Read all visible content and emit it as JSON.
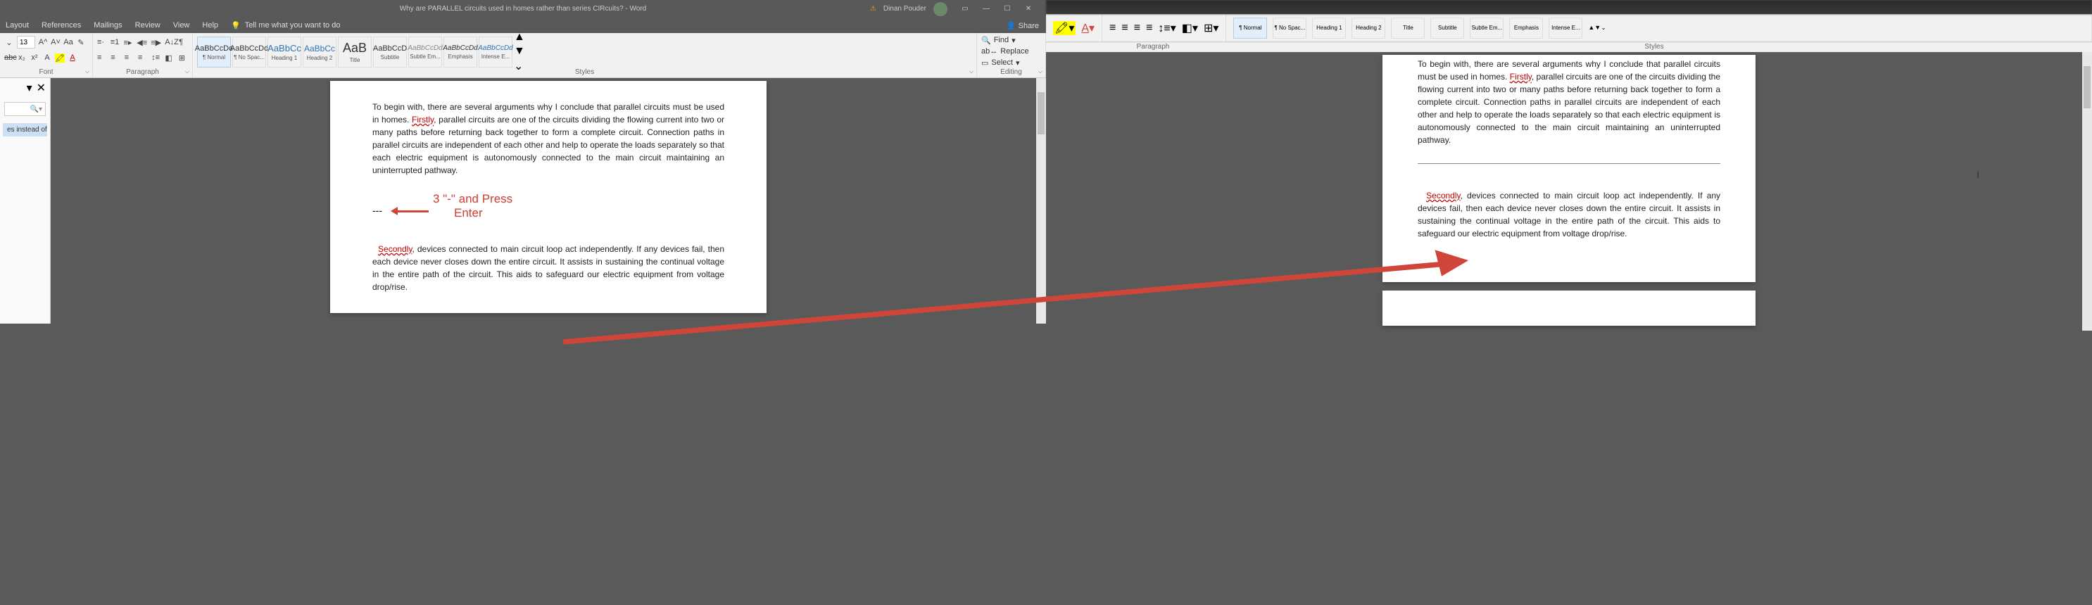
{
  "titlebar": {
    "doc_title": "Why are PARALLEL circuits used in homes rather than series CIRcuits? - Word",
    "user_hint": "Dinan Pouder"
  },
  "ribbon_tabs": {
    "layout": "Layout",
    "references": "References",
    "mailings": "Mailings",
    "review": "Review",
    "view": "View",
    "help": "Help",
    "tell_me": "Tell me what you want to do",
    "share": "Share"
  },
  "font": {
    "size": "13",
    "group_label": "Font"
  },
  "paragraph": {
    "group_label": "Paragraph"
  },
  "styles": {
    "group_label": "Styles",
    "items": [
      {
        "sample": "AaBbCcDd",
        "name": "¶ Normal",
        "cls": ""
      },
      {
        "sample": "AaBbCcDd",
        "name": "¶ No Spac...",
        "cls": ""
      },
      {
        "sample": "AaBbCc",
        "name": "Heading 1",
        "cls": "h1"
      },
      {
        "sample": "AaBbCc",
        "name": "Heading 2",
        "cls": "h2"
      },
      {
        "sample": "AaB",
        "name": "Title",
        "cls": "title"
      },
      {
        "sample": "AaBbCcD",
        "name": "Subtitle",
        "cls": ""
      },
      {
        "sample": "AaBbCcDd",
        "name": "Subtle Em...",
        "cls": "subtle"
      },
      {
        "sample": "AaBbCcDd",
        "name": "Emphasis",
        "cls": "emph"
      },
      {
        "sample": "AaBbCcDd",
        "name": "Intense E...",
        "cls": "intense"
      }
    ]
  },
  "editing": {
    "find": "Find",
    "replace": "Replace",
    "select": "Select",
    "group_label": "Editing"
  },
  "nav": {
    "result": "es instead of se..."
  },
  "doc": {
    "p1_a": "To begin with, there are several arguments why I conclude that parallel circuits must be used in homes. ",
    "p1_flag": "Firstly",
    "p1_b": ", parallel circuits are one of the circuits dividing the flowing current into two or many paths before returning back together to form a complete circuit. Connection paths in parallel circuits are independent of each other and help to operate the loads separately so that each electric equipment is autonomously connected to the main circuit maintaining an uninterrupted pathway.",
    "dashes": "---",
    "callout_1": "3 \"-\" and Press",
    "callout_2": "Enter",
    "p2_flag": "Secondly",
    "p2_b": ", devices connected to main circuit loop act independently. If any devices fail, then each device never closes down the entire circuit. It assists in sustaining the continual voltage in the entire path of the circuit. This aids to safeguard our electric equipment from voltage drop/rise."
  },
  "right_styles": {
    "items": [
      {
        "name": "¶ Normal"
      },
      {
        "name": "¶ No Spac..."
      },
      {
        "name": "Heading 1"
      },
      {
        "name": "Heading 2"
      },
      {
        "name": "Title"
      },
      {
        "name": "Subtitle"
      },
      {
        "name": "Subtle Em..."
      },
      {
        "name": "Emphasis"
      },
      {
        "name": "Intense E..."
      }
    ],
    "para_label": "Paragraph",
    "styles_label": "Styles"
  }
}
